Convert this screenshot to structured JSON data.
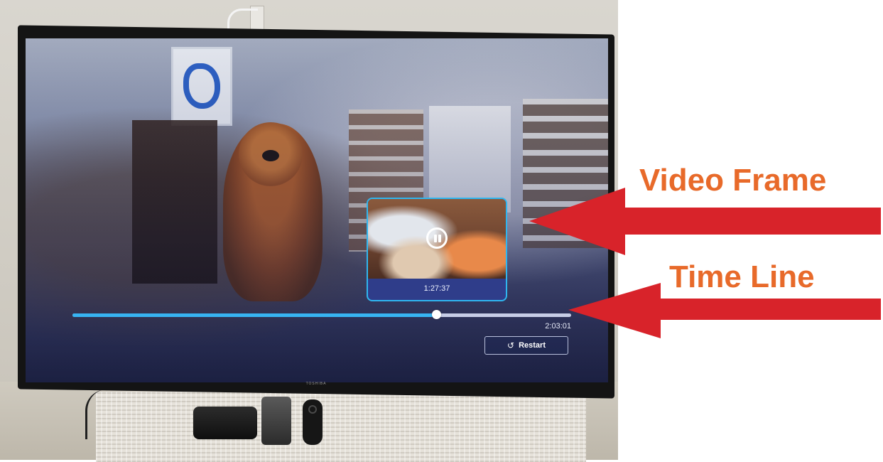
{
  "player": {
    "preview_time": "1:27:37",
    "duration": "2:03:01",
    "progress": 0.73,
    "restart_label": "Restart",
    "restart_icon": "restart-icon"
  },
  "tv": {
    "brand": "TOSHIBA"
  },
  "annotations": [
    {
      "label": "Video Frame",
      "color": "#e86a2a"
    },
    {
      "label": "Time Line",
      "color": "#e86a2a"
    }
  ],
  "arrow_color": "#d8232a"
}
